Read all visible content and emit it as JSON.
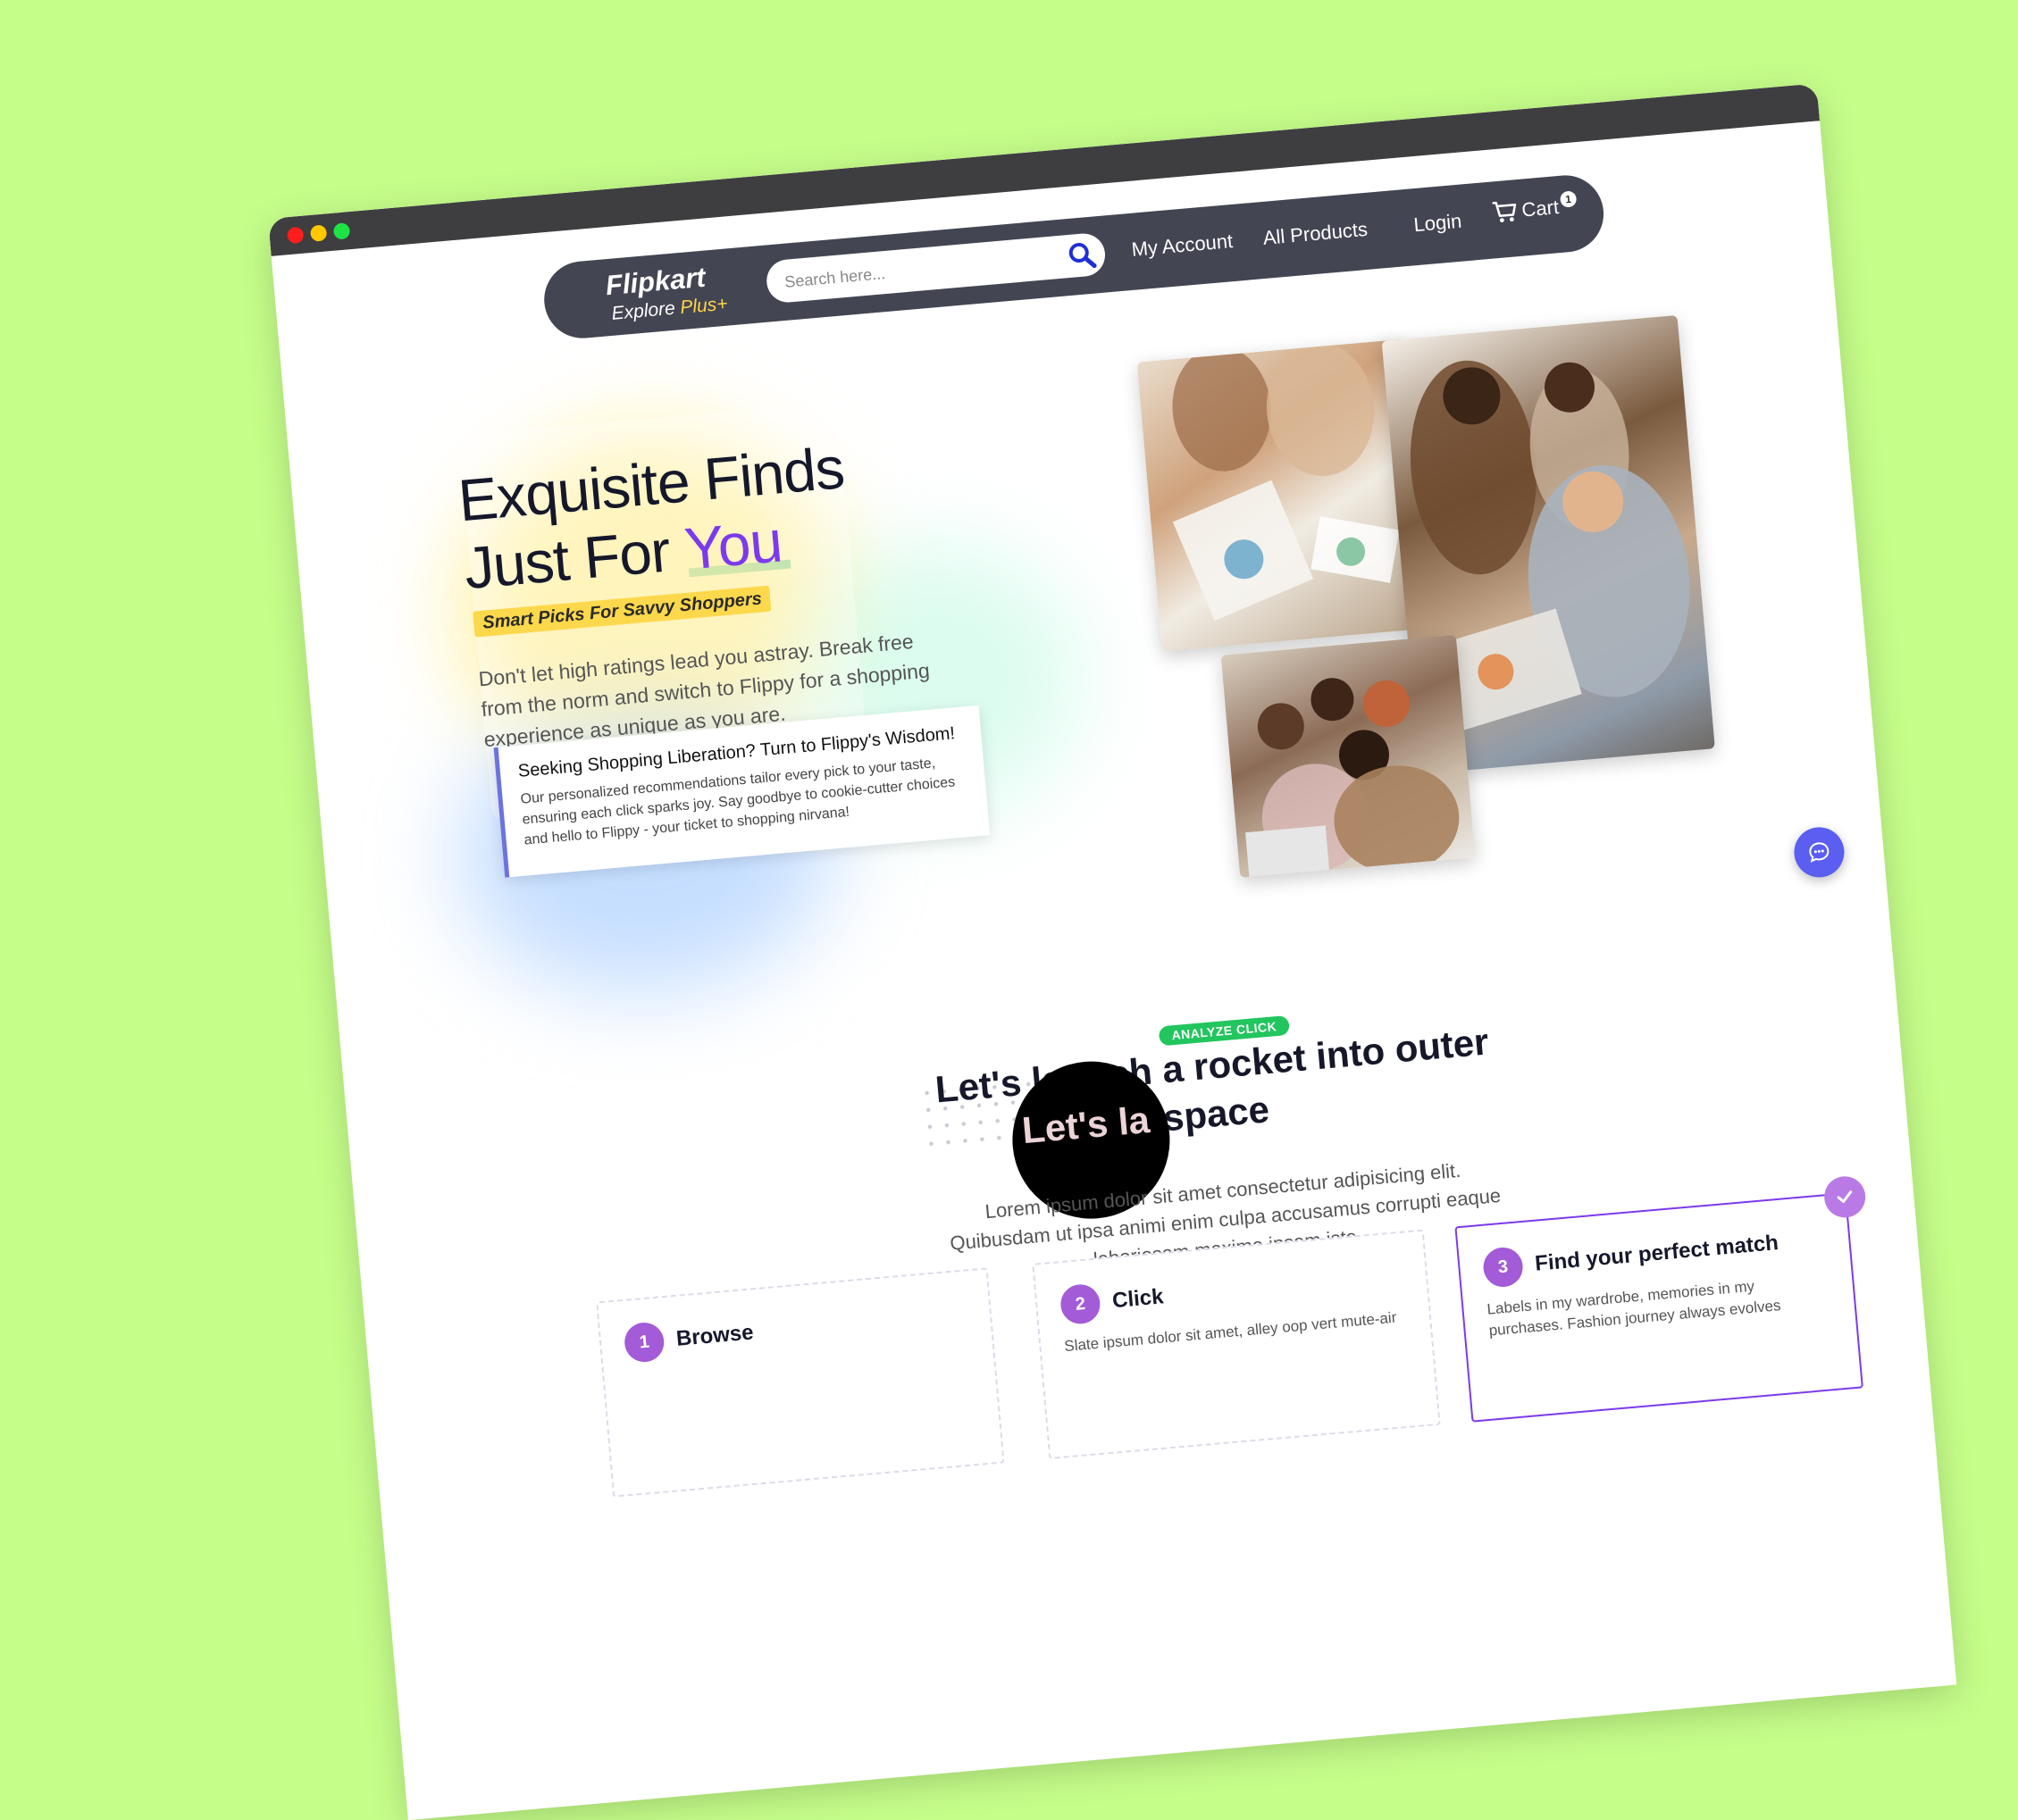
{
  "window": {
    "controls": [
      "close",
      "minimize",
      "maximize"
    ],
    "control_colors": [
      "#ff1d1d",
      "#ffc800",
      "#1ee347"
    ]
  },
  "navbar": {
    "logo_name": "Flipkart",
    "logo_tag": "Explore",
    "logo_plus": "Plus+",
    "search_placeholder": "Search here...",
    "search_icon": "search-icon",
    "links": [
      "My Account",
      "All Products",
      "Login"
    ],
    "cart_label": "Cart",
    "cart_count": "1",
    "cart_icon": "cart-icon"
  },
  "hero": {
    "title_line1": "Exquisite Finds",
    "title_line2_prefix": "Just For ",
    "title_accent": "You",
    "tagline": "Smart Picks For Savvy Shoppers",
    "description": "Don't let high ratings lead you astray. Break free from the norm and switch to Flippy for a shopping experience as unique as you are.",
    "wisdom_title": "Seeking Shopping Liberation? Turn to Flippy's Wisdom!",
    "wisdom_text": "Our personalized recommendations tailor every pick to your taste, ensuring each click sparks joy. Say goodbye to cookie-cutter choices and hello to Flippy - your ticket to shopping nirvana!"
  },
  "section": {
    "badge": "ANALYZE CLICK",
    "title": "Let's launch a rocket into outer space",
    "circle_text": "Let's la",
    "subtitle": "Lorem ipsum dolor sit amet consectetur adipisicing elit. Quibusdam ut ipsa animi enim culpa accusamus corrupti eaque laboriosam maxime ipsam iste."
  },
  "steps": [
    {
      "num": "1",
      "title": "Browse",
      "text": ""
    },
    {
      "num": "2",
      "title": "Click",
      "text": "Slate ipsum dolor sit amet, alley oop vert mute-air"
    },
    {
      "num": "3",
      "title": "Find your perfect match",
      "text": "Labels in my wardrobe, memories in my purchases. Fashion journey always evolves"
    }
  ],
  "chat_icon": "chat-icon",
  "colors": {
    "background": "#c6fe8a",
    "navbar": "#434552",
    "accent_purple": "#7c3aed",
    "accent_teal": "#1fb8a7",
    "badge_green": "#22c55e",
    "chat_button": "#5b5ef0"
  }
}
